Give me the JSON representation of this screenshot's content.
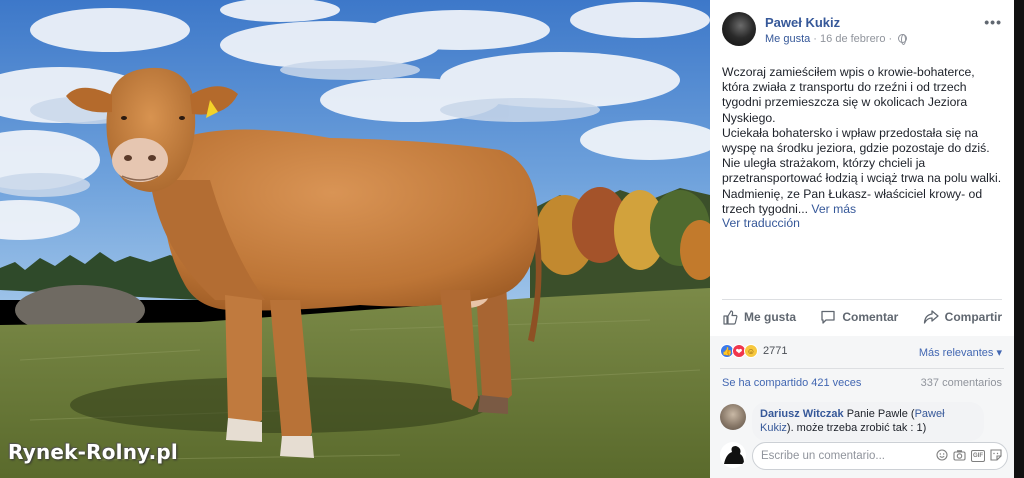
{
  "photo": {
    "watermark": "Rynek-Rolny.pl",
    "alt": "brown-cow-photo"
  },
  "post": {
    "author": "Paweł Kukiz",
    "meta_like": "Me gusta",
    "meta_sep": " · ",
    "date": "16 de febrero",
    "meta_sep2": " · ",
    "more_icon": "•••",
    "text_lines": [
      "Wczoraj zamieściłem wpis o krowie-bohaterce, która zwiała z transportu do rzeźni i od trzech tygodni przemieszcza się w okolicach Jeziora Nyskiego.",
      "Uciekała bohatersko i wpław przedostała się na wyspę na środku jeziora, gdzie pozostaje do dziś. Nie uległa strażakom, którzy chcieli ja przetransportować łodzią i wciąż trwa na polu walki. Nadmienię, ze Pan Łukasz- właściciel krowy- od trzech tygodni... "
    ],
    "see_more": "Ver más",
    "see_translation": "Ver traducción"
  },
  "actions": {
    "like": "Me gusta",
    "comment": "Comentar",
    "share": "Compartir"
  },
  "stats": {
    "reaction_icons": [
      "like-icon",
      "love-icon",
      "haha-icon"
    ],
    "reaction_count": "2771",
    "relevance": "Más relevantes ▾",
    "shares": "Se ha compartido 421 veces",
    "comments": "337 comentarios"
  },
  "comment": {
    "author": "Dariusz Witczak",
    "text_before": " Panie Pawle (",
    "mention": "Paweł Kukiz",
    "text_after": "). może trzeba zrobić tak : 1)"
  },
  "composer": {
    "placeholder": "Escribe un comentario...",
    "tools": [
      "emoji-icon",
      "camera-icon",
      "gif-icon",
      "sticker-icon"
    ],
    "gif_label": "GIF"
  },
  "colors": {
    "link": "#365899",
    "sky": "#5b8fd0",
    "cow": "#c07a3c",
    "grass": "#6b7a3a"
  }
}
